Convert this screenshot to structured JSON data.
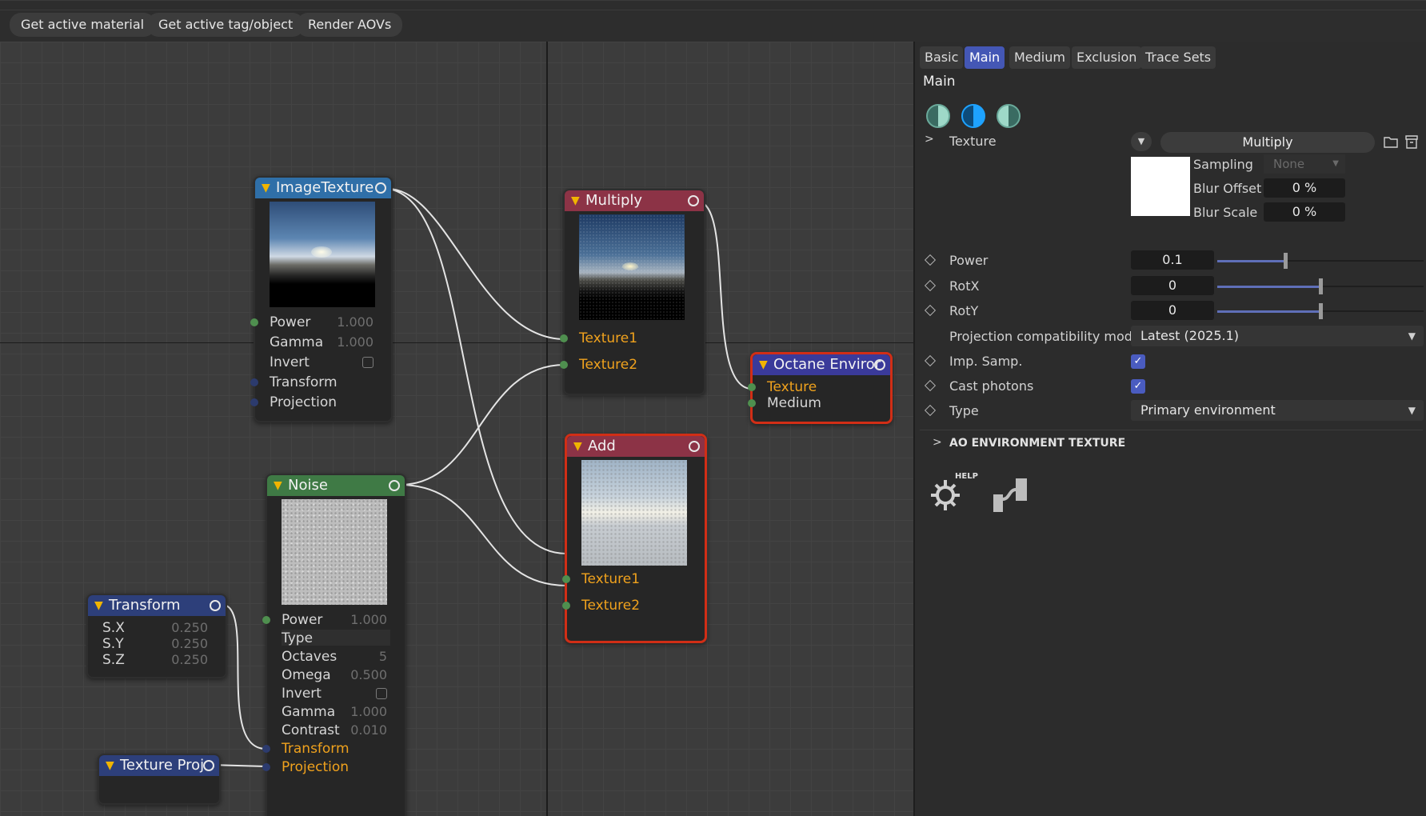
{
  "toolbar": {
    "get_active_material": "Get active material",
    "get_active_tag_object": "Get active tag/object",
    "render_aovs": "Render AOVs"
  },
  "nodes": {
    "image_texture": {
      "title": "ImageTexture",
      "params": [
        {
          "label": "Power",
          "value": "1.000"
        },
        {
          "label": "Gamma",
          "value": "1.000"
        },
        {
          "label": "Invert"
        },
        {
          "label": "Transform"
        },
        {
          "label": "Projection"
        }
      ]
    },
    "multiply": {
      "title": "Multiply",
      "inputs": [
        "Texture1",
        "Texture2"
      ]
    },
    "octane_env": {
      "title": "Octane Enviror",
      "inputs": [
        "Texture",
        "Medium"
      ]
    },
    "add": {
      "title": "Add",
      "inputs": [
        "Texture1",
        "Texture2"
      ]
    },
    "noise": {
      "title": "Noise",
      "params": [
        {
          "label": "Power",
          "value": "1.000"
        },
        {
          "label": "Type",
          "value": ""
        },
        {
          "label": "Octaves",
          "value": "5"
        },
        {
          "label": "Omega",
          "value": "0.500"
        },
        {
          "label": "Invert"
        },
        {
          "label": "Gamma",
          "value": "1.000"
        },
        {
          "label": "Contrast",
          "value": "0.010"
        },
        {
          "label": "Transform"
        },
        {
          "label": "Projection"
        }
      ]
    },
    "transform": {
      "title": "Transform",
      "params": [
        {
          "label": "S.X",
          "value": "0.250"
        },
        {
          "label": "S.Y",
          "value": "0.250"
        },
        {
          "label": "S.Z",
          "value": "0.250"
        }
      ]
    },
    "texture_proj": {
      "title": "Texture Proj"
    }
  },
  "panel": {
    "tabs": [
      "Basic",
      "Main",
      "Medium",
      "Exclusion",
      "Trace Sets"
    ],
    "active_tab": "Main",
    "section_title": "Main",
    "texture_label": "Texture",
    "texture_value": "Multiply",
    "sampling_label": "Sampling",
    "sampling_value": "None",
    "blur_offset_label": "Blur Offset",
    "blur_offset_value": "0 %",
    "blur_scale_label": "Blur Scale",
    "blur_scale_value": "0 %",
    "power_label": "Power",
    "power_value": "0.1",
    "rotx_label": "RotX",
    "rotx_value": "0",
    "roty_label": "RotY",
    "roty_value": "0",
    "projection_label": "Projection compatibility mode",
    "projection_value": "Latest (2025.1)",
    "imp_samp_label": "Imp. Samp.",
    "imp_samp_checked": true,
    "cast_photons_label": "Cast photons",
    "cast_photons_checked": true,
    "type_label": "Type",
    "type_value": "Primary environment",
    "ao_section": "AO ENVIRONMENT TEXTURE",
    "help_label": "HELP",
    "power_slider_fraction": 0.33,
    "rotx_slider_fraction": 0.5,
    "roty_slider_fraction": 0.5
  },
  "colors": {
    "accent": "#4457b5",
    "selected_border": "#d12e16",
    "port_label_connected": "#f0a21d"
  }
}
